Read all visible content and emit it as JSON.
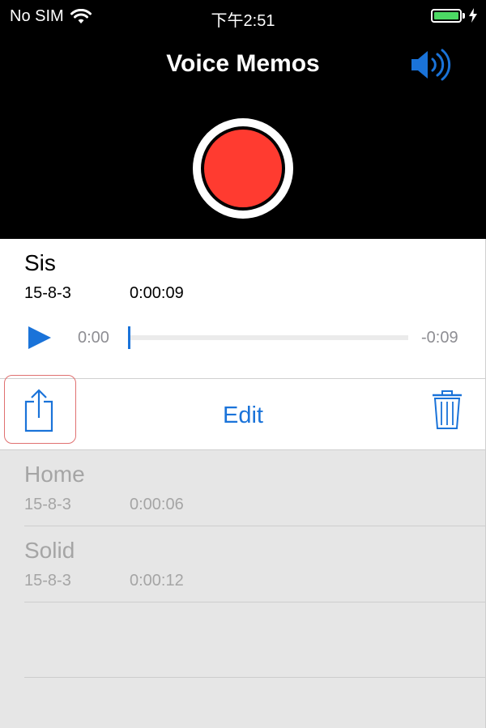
{
  "status_bar": {
    "carrier": "No SIM",
    "time": "下午2:51",
    "battery_level": 1.0,
    "battery_color": "#4cd964"
  },
  "header": {
    "title": "Voice Memos",
    "speaker_icon": "speaker-icon",
    "record_color": "#ff3b30"
  },
  "selected_memo": {
    "name": "Sis",
    "date": "15-8-3",
    "duration": "0:00:09",
    "elapsed": "0:00",
    "remaining": "-0:09",
    "progress": 0.0,
    "accent": "#1a73d9"
  },
  "actions": {
    "share_icon": "share-icon",
    "edit_label": "Edit",
    "trash_icon": "trash-icon"
  },
  "memos": [
    {
      "name": "Home",
      "date": "15-8-3",
      "duration": "0:00:06"
    },
    {
      "name": "Solid",
      "date": "15-8-3",
      "duration": "0:00:12"
    }
  ]
}
